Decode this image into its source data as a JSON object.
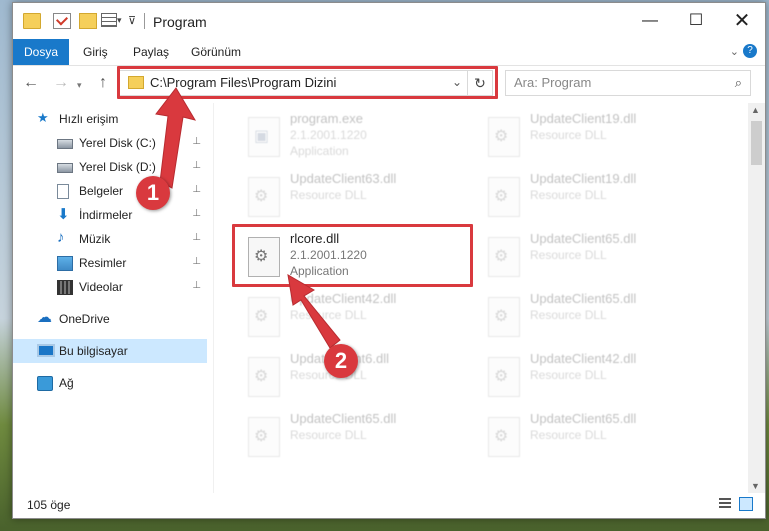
{
  "window": {
    "title": "Program",
    "controls": {
      "minimize": "—",
      "maximize": "☐",
      "close": "✕"
    }
  },
  "ribbon": {
    "tabs": [
      "Dosya",
      "Giriş",
      "Paylaş",
      "Görünüm"
    ],
    "expand_glyph": "⌄",
    "help_glyph": "?"
  },
  "navbar": {
    "address": "C:\\Program Files\\Program Dizini",
    "search_placeholder": "Ara: Program"
  },
  "sidebar": {
    "items": [
      {
        "label": "Hızlı erişim",
        "icon": "star-icon",
        "pinned": false
      },
      {
        "label": "Yerel Disk (C:)",
        "icon": "disk-icon",
        "pinned": true
      },
      {
        "label": "Yerel Disk (D:)",
        "icon": "disk-icon",
        "pinned": true
      },
      {
        "label": "Belgeler",
        "icon": "document-icon",
        "pinned": true
      },
      {
        "label": "İndirmeler",
        "icon": "download-icon",
        "pinned": true
      },
      {
        "label": "Müzik",
        "icon": "music-icon",
        "pinned": true
      },
      {
        "label": "Resimler",
        "icon": "picture-icon",
        "pinned": true
      },
      {
        "label": "Videolar",
        "icon": "video-icon",
        "pinned": true
      },
      {
        "label": "OneDrive",
        "icon": "cloud-icon",
        "pinned": false
      },
      {
        "label": "Bu bilgisayar",
        "icon": "computer-icon",
        "pinned": false,
        "selected": true
      },
      {
        "label": "Ağ",
        "icon": "network-icon",
        "pinned": false
      }
    ]
  },
  "files": [
    {
      "name": "program.exe",
      "meta1": "2.1.2001.1220",
      "meta2": "Application",
      "icon": "exe-icon",
      "highlighted": false
    },
    {
      "name": "UpdateClient19.dll",
      "meta1": "Resource DLL",
      "meta2": "",
      "icon": "dll-icon",
      "highlighted": false
    },
    {
      "name": "UpdateClient63.dll",
      "meta1": "Resource DLL",
      "meta2": "",
      "icon": "dll-icon",
      "highlighted": false
    },
    {
      "name": "UpdateClient19.dll",
      "meta1": "Resource DLL",
      "meta2": "",
      "icon": "dll-icon",
      "highlighted": false
    },
    {
      "name": "rlcore.dll",
      "meta1": "2.1.2001.1220",
      "meta2": "Application",
      "icon": "dll-icon",
      "highlighted": true
    },
    {
      "name": "UpdateClient65.dll",
      "meta1": "Resource DLL",
      "meta2": "",
      "icon": "dll-icon",
      "highlighted": false
    },
    {
      "name": "UpdateClient42.dll",
      "meta1": "Resource DLL",
      "meta2": "",
      "icon": "dll-icon",
      "highlighted": false
    },
    {
      "name": "UpdateClient65.dll",
      "meta1": "Resource DLL",
      "meta2": "",
      "icon": "dll-icon",
      "highlighted": false
    },
    {
      "name": "UpdateClient6.dll",
      "meta1": "Resource DLL",
      "meta2": "",
      "icon": "dll-icon",
      "highlighted": false
    },
    {
      "name": "UpdateClient42.dll",
      "meta1": "Resource DLL",
      "meta2": "",
      "icon": "dll-icon",
      "highlighted": false
    },
    {
      "name": "UpdateClient65.dll",
      "meta1": "Resource DLL",
      "meta2": "",
      "icon": "dll-icon",
      "highlighted": false
    },
    {
      "name": "UpdateClient65.dll",
      "meta1": "Resource DLL",
      "meta2": "",
      "icon": "dll-icon",
      "highlighted": false
    }
  ],
  "status": {
    "item_count": "105 öge"
  },
  "annotations": [
    {
      "number": "1",
      "target": "address-bar"
    },
    {
      "number": "2",
      "target": "rlcore.dll"
    }
  ],
  "colors": {
    "accent": "#1979ca",
    "highlight": "#d9393e",
    "selected": "#cce8ff"
  }
}
